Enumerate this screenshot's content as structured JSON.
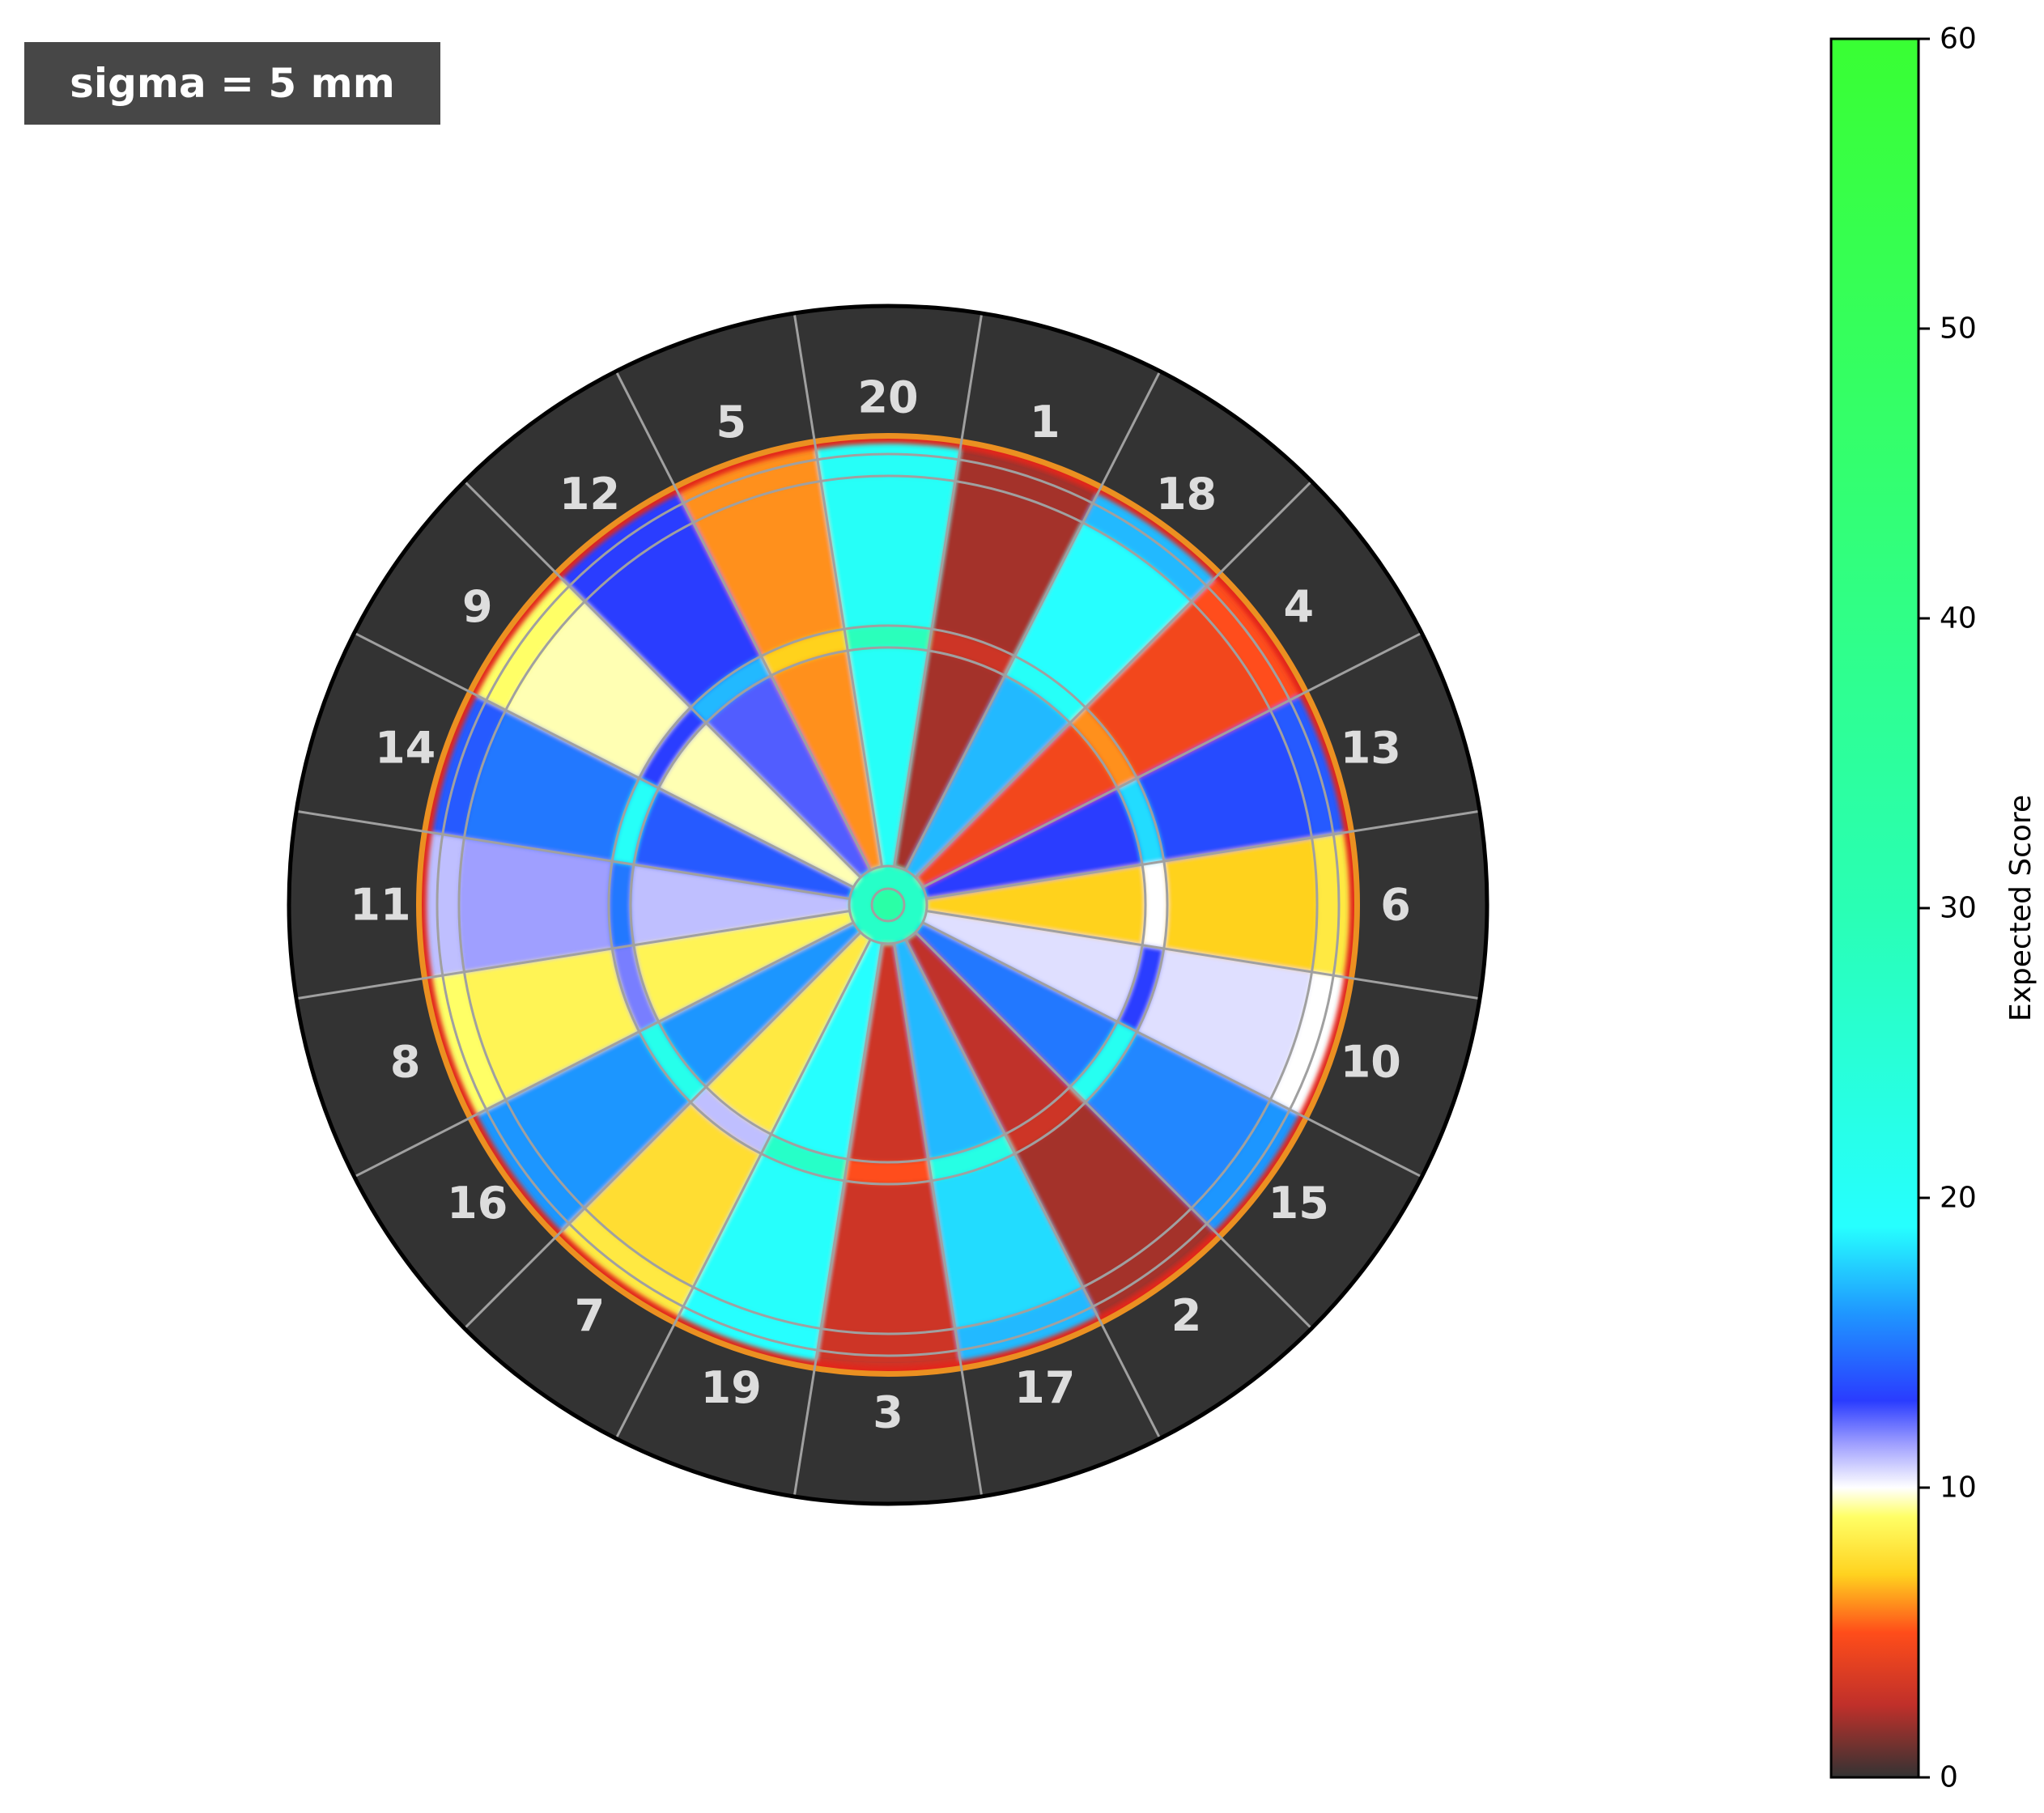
{
  "annotation": "sigma = 5 mm",
  "colorbar": {
    "label": "Expected Score",
    "range": [
      0,
      60
    ],
    "ticks": [
      "0",
      "10",
      "20",
      "30",
      "40",
      "50",
      "60"
    ],
    "stops": [
      {
        "v": 0,
        "c": "#333333"
      },
      {
        "v": 2.5,
        "c": "#c0302a"
      },
      {
        "v": 5,
        "c": "#ff4d1a"
      },
      {
        "v": 7,
        "c": "#ffd21f"
      },
      {
        "v": 9,
        "c": "#ffff66"
      },
      {
        "v": 10,
        "c": "#ffffff"
      },
      {
        "v": 11.5,
        "c": "#9f9fff"
      },
      {
        "v": 13,
        "c": "#2a3cff"
      },
      {
        "v": 16,
        "c": "#1f96ff"
      },
      {
        "v": 19,
        "c": "#26ffff"
      },
      {
        "v": 30,
        "c": "#29ffb4"
      },
      {
        "v": 45,
        "c": "#33ff70"
      },
      {
        "v": 60,
        "c": "#39ff33"
      }
    ]
  },
  "chart_data": {
    "type": "heatmap",
    "title": "",
    "segment_order": [
      "20",
      "1",
      "18",
      "4",
      "13",
      "6",
      "10",
      "15",
      "2",
      "17",
      "3",
      "19",
      "7",
      "16",
      "8",
      "11",
      "14",
      "9",
      "12",
      "5"
    ],
    "value_range": [
      0,
      60
    ],
    "bull": {
      "inner_bull": 33,
      "outer_bull": 27
    },
    "segments": [
      {
        "label": "20",
        "inner_single": 20,
        "triple": 29,
        "outer_single": 20,
        "double": 20
      },
      {
        "label": "1",
        "inner_single": 2,
        "triple": 3,
        "outer_single": 2,
        "double": 2
      },
      {
        "label": "18",
        "inner_single": 17,
        "triple": 20,
        "outer_single": 19,
        "double": 17
      },
      {
        "label": "4",
        "inner_single": 4.5,
        "triple": 6,
        "outer_single": 4.5,
        "double": 5
      },
      {
        "label": "13",
        "inner_single": 13,
        "triple": 18,
        "outer_single": 13.5,
        "double": 14
      },
      {
        "label": "6",
        "inner_single": 7,
        "triple": 10,
        "outer_single": 7,
        "double": 8
      },
      {
        "label": "10",
        "inner_single": 10.5,
        "triple": 13,
        "outer_single": 10.5,
        "double": 10
      },
      {
        "label": "15",
        "inner_single": 15,
        "triple": 21,
        "outer_single": 15.5,
        "double": 16
      },
      {
        "label": "2",
        "inner_single": 2.5,
        "triple": 3,
        "outer_single": 2,
        "double": 2
      },
      {
        "label": "17",
        "inner_single": 17,
        "triple": 23,
        "outer_single": 18,
        "double": 17
      },
      {
        "label": "3",
        "inner_single": 3,
        "triple": 5,
        "outer_single": 3,
        "double": 3
      },
      {
        "label": "19",
        "inner_single": 19,
        "triple": 27,
        "outer_single": 19.5,
        "double": 19
      },
      {
        "label": "7",
        "inner_single": 8,
        "triple": 11,
        "outer_single": 7.5,
        "double": 8
      },
      {
        "label": "16",
        "inner_single": 16,
        "triple": 22,
        "outer_single": 16,
        "double": 16
      },
      {
        "label": "8",
        "inner_single": 8.5,
        "triple": 12,
        "outer_single": 8.5,
        "double": 9
      },
      {
        "label": "11",
        "inner_single": 11,
        "triple": 15,
        "outer_single": 11.5,
        "double": 11
      },
      {
        "label": "14",
        "inner_single": 14,
        "triple": 20,
        "outer_single": 15,
        "double": 14
      },
      {
        "label": "9",
        "inner_single": 9.5,
        "triple": 13,
        "outer_single": 9.5,
        "double": 9
      },
      {
        "label": "12",
        "inner_single": 12.5,
        "triple": 17,
        "outer_single": 13,
        "double": 13
      },
      {
        "label": "5",
        "inner_single": 6,
        "triple": 7,
        "outer_single": 6,
        "double": 6
      }
    ]
  }
}
